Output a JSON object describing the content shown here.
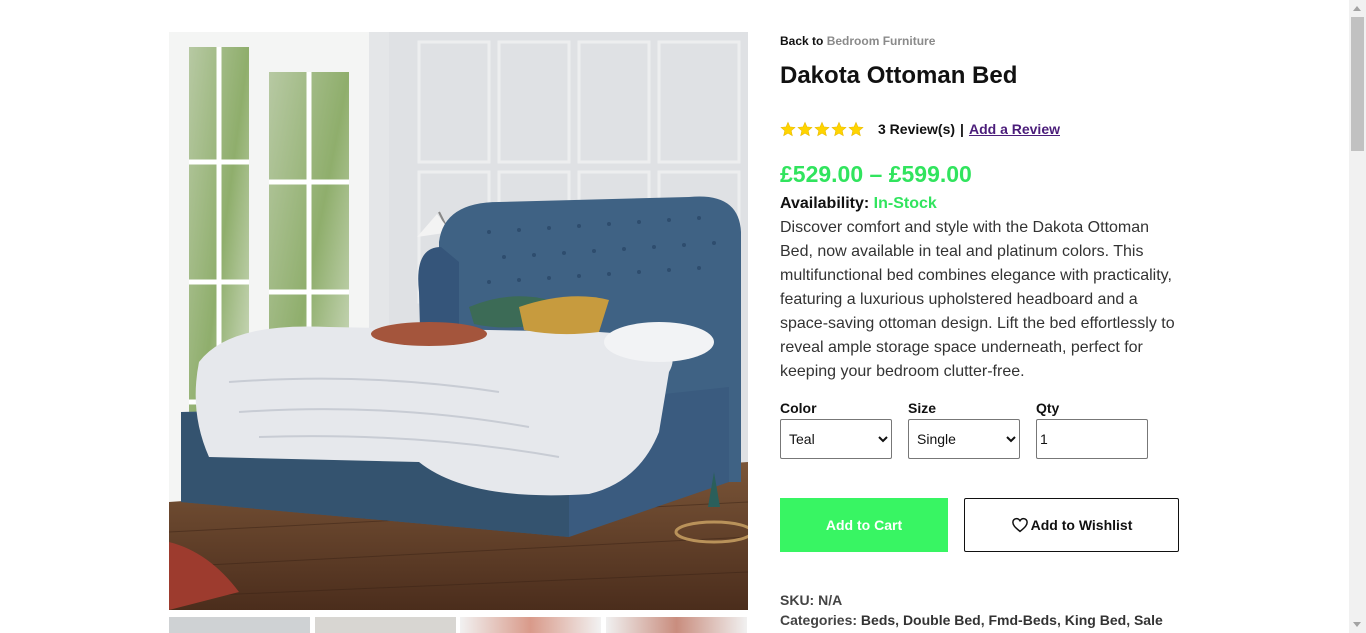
{
  "breadcrumb": {
    "prefix": "Back to",
    "link": "Bedroom Furniture"
  },
  "product": {
    "title": "Dakota Ottoman Bed",
    "rating": 5,
    "reviews_text": "3 Review(s)",
    "separator": "|",
    "add_review": "Add a Review",
    "price": "£529.00 – £599.00",
    "availability_label": "Availability:",
    "availability_value": "In-Stock",
    "description": "Discover comfort and style with the Dakota Ottoman Bed, now available in teal and platinum colors. This multifunctional bed combines elegance with practicality, featuring a luxurious upholstered headboard and a space-saving ottoman design. Lift the bed effortlessly to reveal ample storage space underneath, perfect for keeping your bedroom clutter-free."
  },
  "options": {
    "color_label": "Color",
    "color_selected": "Teal",
    "size_label": "Size",
    "size_selected": "Single",
    "qty_label": "Qty",
    "qty_value": "1"
  },
  "buttons": {
    "cart": "Add to Cart",
    "wishlist": "Add to Wishlist"
  },
  "meta": {
    "sku_label": "SKU:",
    "sku_value": "N/A",
    "categories_label": "Categories:",
    "categories": [
      "Beds",
      "Double Bed",
      "Fmd-Beds",
      "King Bed",
      "Sale"
    ]
  },
  "icons": {
    "star": "star-icon",
    "heart": "heart-icon",
    "select_arrow": "chevron-down-icon"
  },
  "colors": {
    "accent_green": "#31e45e",
    "cart_button": "#38f563",
    "star": "#ffd400",
    "review_link": "#4b1d7a"
  }
}
